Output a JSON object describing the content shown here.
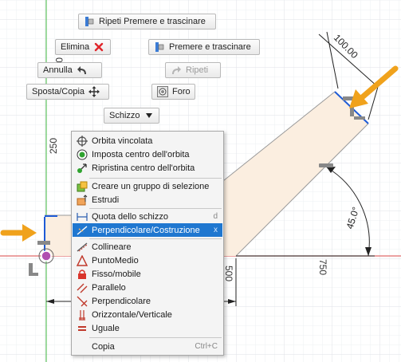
{
  "toolbar": {
    "ripeti_premere": "Ripeti Premere e trascinare",
    "elimina": "Elimina",
    "premere_trascinare": "Premere e trascinare",
    "annulla": "Annulla",
    "ripeti": "Ripeti",
    "sposta_copia": "Sposta/Copia",
    "foro": "Foro",
    "schizzo": "Schizzo"
  },
  "dimensions": {
    "length": "100.00",
    "angle": "45.0°",
    "axis_250": "250",
    "axis_500": "500",
    "axis_750": "750",
    "partial": "00"
  },
  "context_menu": {
    "items": [
      {
        "label": "Orbita vincolata",
        "icon": "orbit-constrained-icon"
      },
      {
        "label": "Imposta centro dell'orbita",
        "icon": "set-orbit-center-icon"
      },
      {
        "label": "Ripristina centro dell'orbita",
        "icon": "reset-orbit-center-icon"
      },
      {
        "label": "Creare un gruppo di selezione",
        "icon": "selection-group-icon"
      },
      {
        "label": "Estrudi",
        "icon": "extrude-icon"
      },
      {
        "label": "Quota dello schizzo",
        "shortcut": "d",
        "icon": "sketch-dimension-icon"
      },
      {
        "label": "Perpendicolare/Costruzione",
        "shortcut": "x",
        "icon": "construction-icon"
      },
      {
        "label": "Collineare",
        "icon": "collinear-icon"
      },
      {
        "label": "PuntoMedio",
        "icon": "midpoint-icon"
      },
      {
        "label": "Fisso/mobile",
        "icon": "lock-icon"
      },
      {
        "label": "Parallelo",
        "icon": "parallel-icon"
      },
      {
        "label": "Perpendicolare",
        "icon": "perpendicular-icon"
      },
      {
        "label": "Orizzontale/Verticale",
        "icon": "horizontal-vertical-icon"
      },
      {
        "label": "Uguale",
        "icon": "equal-icon"
      },
      {
        "label": "Copia",
        "shortcut": "Ctrl+C",
        "icon": ""
      }
    ]
  },
  "colors": {
    "accent": "#1f77d0",
    "arrow": "#f0a21c",
    "sketch_line": "#1e5bd6",
    "fill": "#fbeee0",
    "axis_red": "#e06a6a",
    "axis_green": "#5ec35e"
  }
}
